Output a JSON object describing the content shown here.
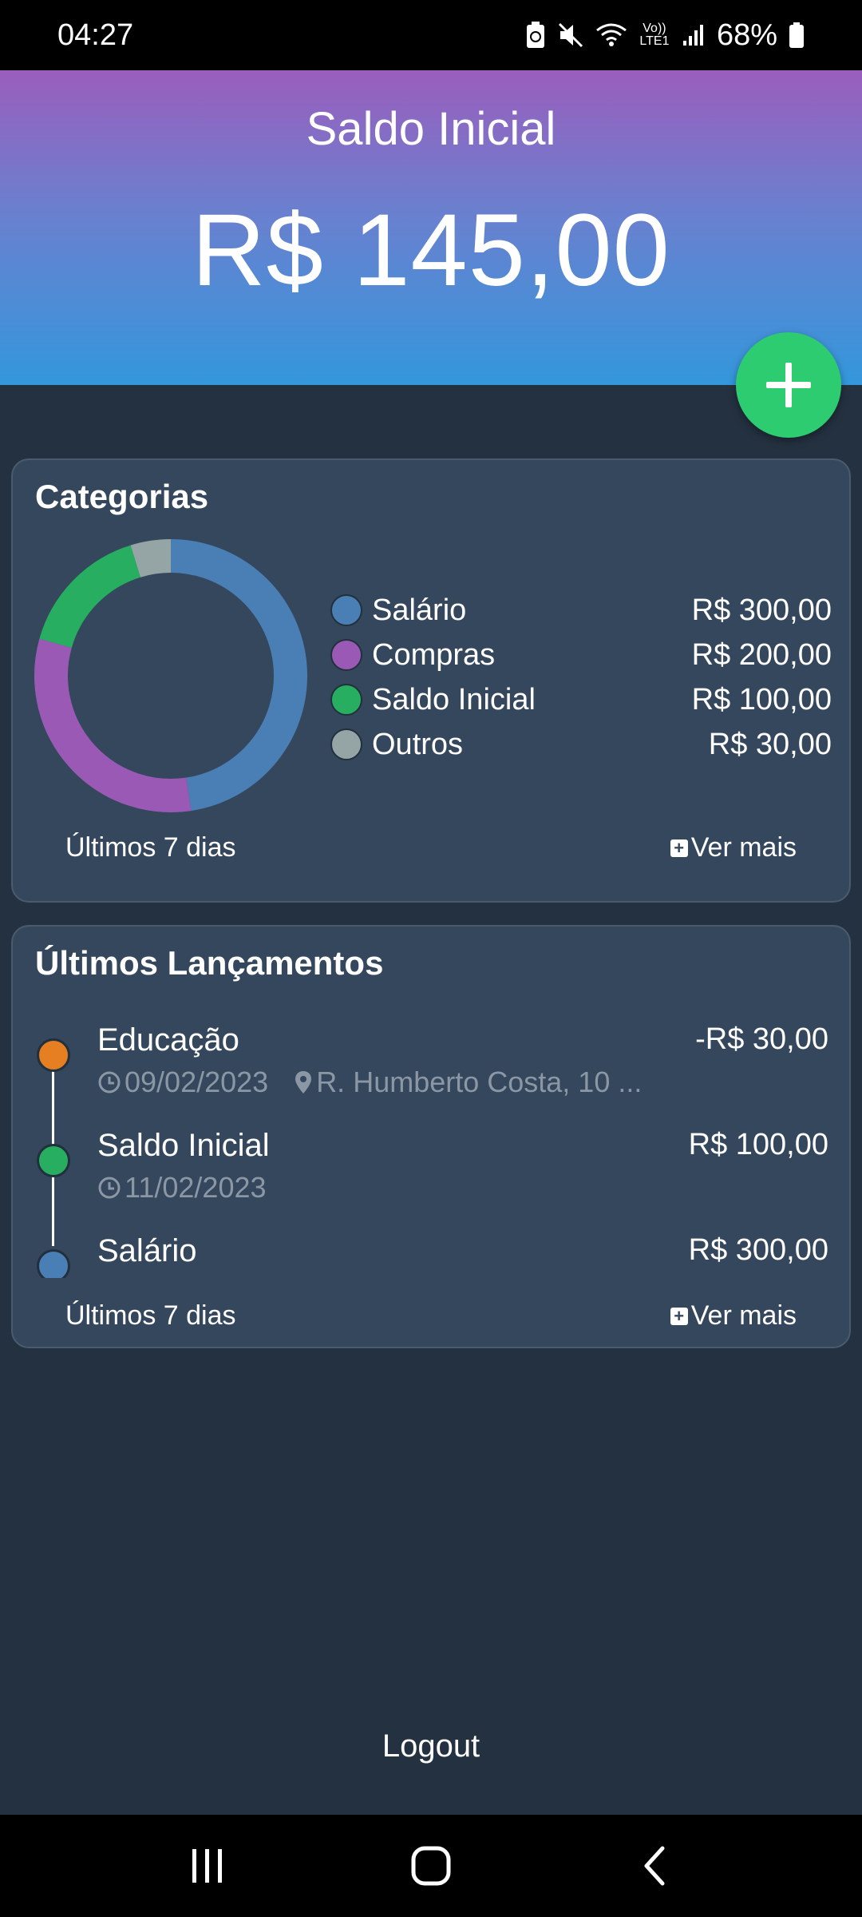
{
  "status_bar": {
    "time": "04:27",
    "battery": "68%",
    "network_label": "Vo)) LTE1",
    "icons": [
      "battery-saver-icon",
      "mute-icon",
      "wifi-icon",
      "lte-icon",
      "signal-icon",
      "battery-icon"
    ]
  },
  "header": {
    "title": "Saldo Inicial",
    "amount": "R$ 145,00",
    "fab_icon": "plus-icon",
    "gradient": [
      "#9a5ebd",
      "#3497dc"
    ]
  },
  "categories": {
    "title": "Categorias",
    "items": [
      {
        "label": "Salário",
        "value": "R$ 300,00",
        "amount": 300,
        "color": "#4a7fb5"
      },
      {
        "label": "Compras",
        "value": "R$ 200,00",
        "amount": 200,
        "color": "#9b59b6"
      },
      {
        "label": "Saldo Inicial",
        "value": "R$ 100,00",
        "amount": 100,
        "color": "#27ae60"
      },
      {
        "label": "Outros",
        "value": "R$ 30,00",
        "amount": 30,
        "color": "#95a5a6"
      }
    ],
    "footer_left": "Últimos 7 dias",
    "footer_right": "Ver mais"
  },
  "transactions": {
    "title": "Últimos Lançamentos",
    "items": [
      {
        "name": "Educação",
        "amount": "-R$ 30,00",
        "date": "09/02/2023",
        "location": "R. Humberto Costa, 10 ...",
        "color": "#e67e22"
      },
      {
        "name": "Saldo Inicial",
        "amount": "R$ 100,00",
        "date": "11/02/2023",
        "color": "#27ae60"
      },
      {
        "name": "Salário",
        "amount": "R$ 300,00",
        "color": "#4a7fb5"
      }
    ],
    "footer_left": "Últimos 7 dias",
    "footer_right": "Ver mais"
  },
  "logout_label": "Logout",
  "nav": {
    "recents_icon": "recents-icon",
    "home_icon": "home-icon",
    "back_icon": "back-icon"
  },
  "colors": {
    "background": "#243140",
    "card": "#34475c",
    "fab": "#2ecc71"
  }
}
